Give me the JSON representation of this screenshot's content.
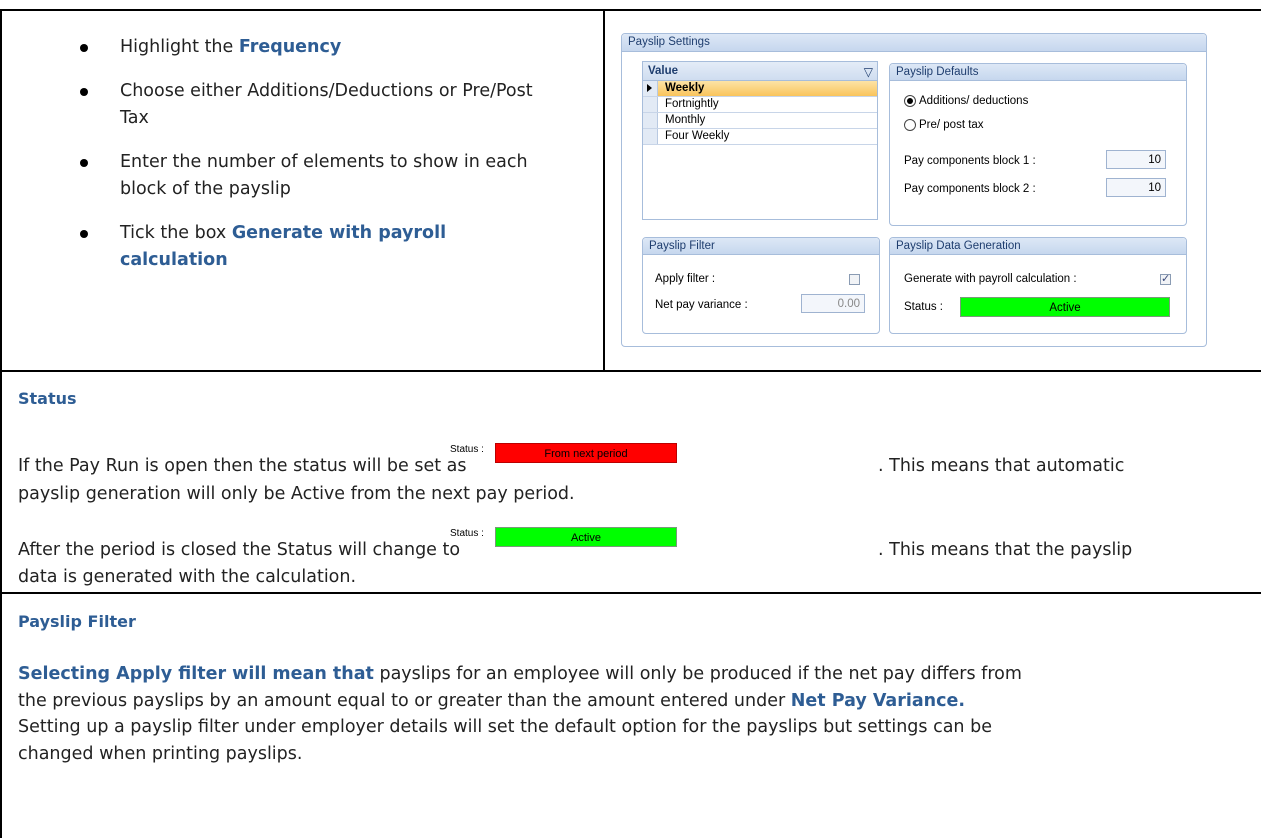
{
  "bullets": [
    {
      "plain": "Highlight the ",
      "bold": "Frequency"
    },
    {
      "plain": "Choose either Additions/Deductions or Pre/Post Tax",
      "bold": ""
    },
    {
      "plain": "Enter the number of elements to show in each block of the payslip",
      "bold": ""
    },
    {
      "plain": "Tick the box ",
      "bold": "Generate with payroll calculation"
    }
  ],
  "widget": {
    "title": "Payslip Settings",
    "grid": {
      "header": "Value",
      "rows": [
        "Weekly",
        "Fortnightly",
        "Monthly",
        "Four Weekly"
      ],
      "selected_index": 0
    },
    "defaults": {
      "title": "Payslip Defaults",
      "radio1": "Additions/ deductions",
      "radio2": "Pre/ post tax",
      "radio_selected": "Additions/ deductions",
      "block1_label": "Pay components block 1 :",
      "block1_value": "10",
      "block2_label": "Pay components block 2 :",
      "block2_value": "10"
    },
    "filter": {
      "title": "Payslip Filter",
      "apply_label": "Apply filter :",
      "apply_checked": false,
      "variance_label": "Net pay variance :",
      "variance_value": "0.00"
    },
    "generation": {
      "title": "Payslip Data Generation",
      "generate_label": "Generate with payroll calculation :",
      "generate_checked": true,
      "status_label": "Status :",
      "status_value": "Active",
      "status_color": "#00ff00"
    }
  },
  "status_section": {
    "heading": "Status",
    "p1_before": "If the Pay Run is open then the status will be set as",
    "p1_after": ". This means that automatic",
    "p1_line2": "payslip generation will only be Active from the next pay period.",
    "inline1_label": "Status :",
    "inline1_value": "From next period",
    "inline1_color": "#ff0000",
    "p2_before": "After the period is closed the Status will change to",
    "p2_after": ". This means that the payslip",
    "p2_line2": "data is generated with the calculation.",
    "inline2_label": "Status :",
    "inline2_value": "Active",
    "inline2_color": "#00ff00"
  },
  "filter_section": {
    "heading": "Payslip Filter",
    "line1_bold": "Selecting Apply filter will mean that",
    "line1_plain": " payslips for an employee will only be produced if the net pay differs from",
    "line2_plain": "the previous payslips by an amount equal to or greater than the amount entered under ",
    "line2_bold": "Net Pay Variance.",
    "line3": "Setting up a payslip filter under employer details will set the default option for the payslips but settings can be",
    "line4": "changed when printing payslips."
  }
}
